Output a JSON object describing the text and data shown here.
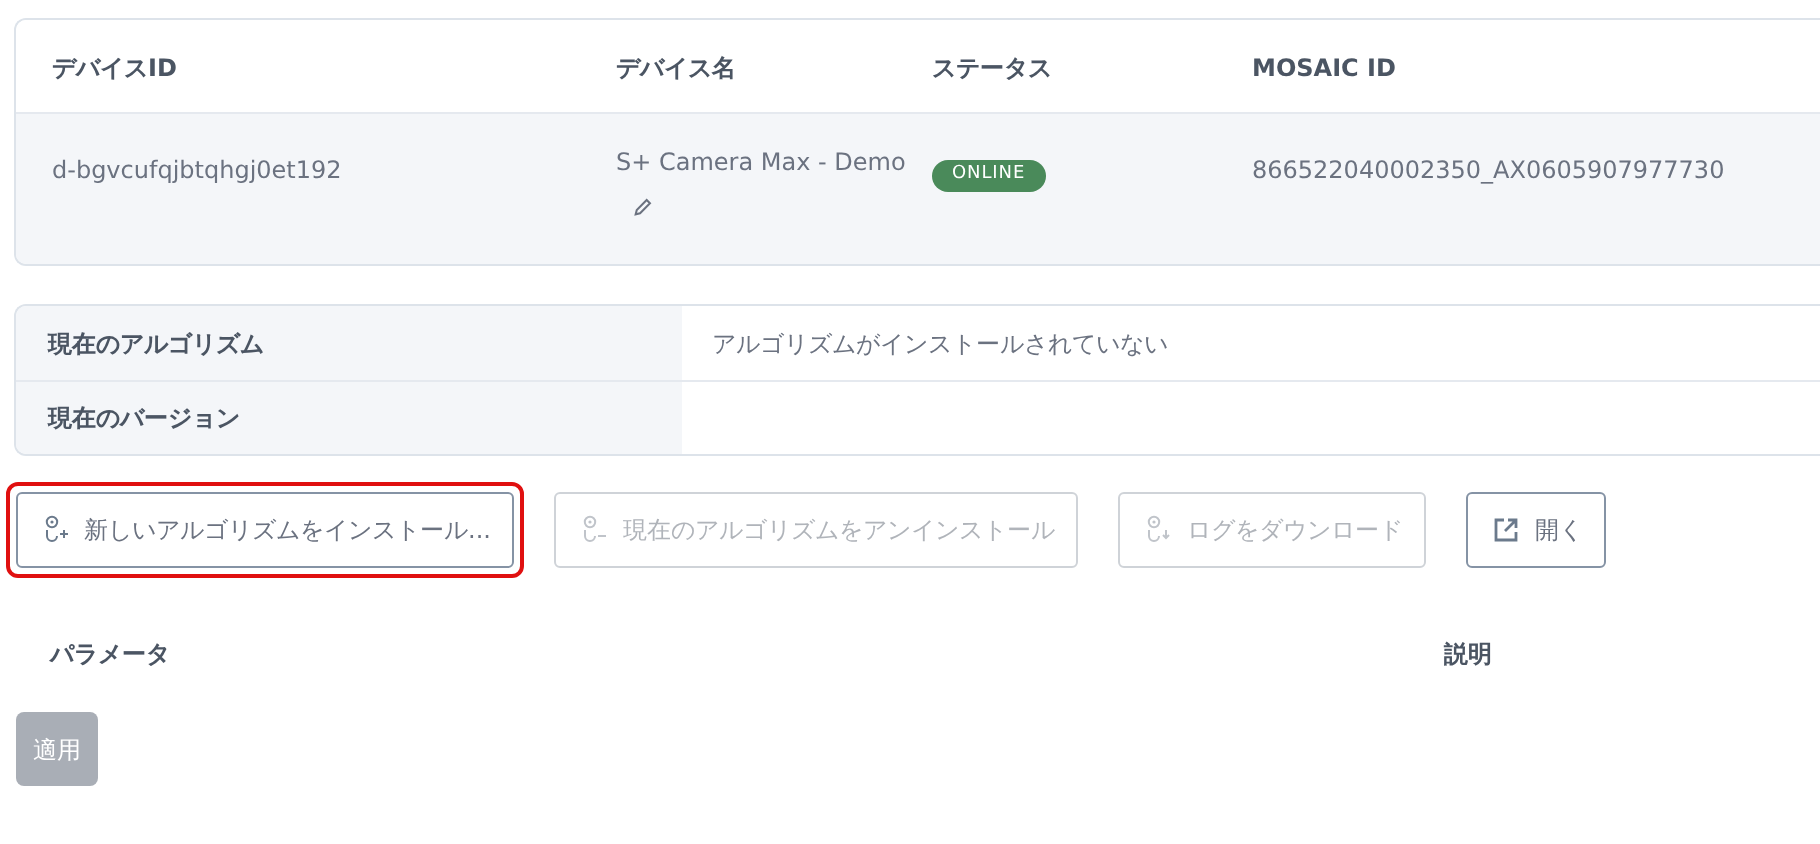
{
  "device_table": {
    "columns": [
      "デバイスID",
      "デバイス名",
      "ステータス",
      "MOSAIC ID"
    ],
    "row": {
      "device_id": "d-bgvcufqjbtqhgj0et192",
      "device_name": "S+ Camera Max - Demo",
      "status": "ONLINE",
      "online": true,
      "mosaic_id": "866522040002350_AX0605907977730"
    }
  },
  "algorithm_info": [
    {
      "label": "現在のアルゴリズム",
      "value": "アルゴリズムがインストールされていない"
    },
    {
      "label": "現在のバージョン"
    }
  ],
  "actions": [
    {
      "label": "新しいアルゴリズムをインストール...",
      "kind": "install",
      "disabled": false,
      "highlighted": true
    },
    {
      "label": "現在のアルゴリズムをアンインストール",
      "kind": "uninstall",
      "disabled": true,
      "highlighted": false
    },
    {
      "label": "ログをダウンロード",
      "kind": "download",
      "disabled": true,
      "highlighted": false
    },
    {
      "label": "開く",
      "kind": "open",
      "disabled": false,
      "highlighted": false
    }
  ],
  "parameters": {
    "columns": [
      "パラメータ",
      "説明"
    ]
  },
  "apply_button": {
    "label": "適用",
    "disabled": true
  }
}
